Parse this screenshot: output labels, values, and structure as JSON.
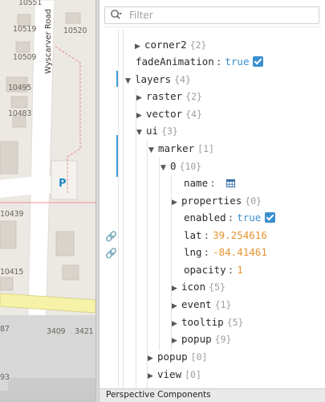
{
  "map": {
    "road_label": "Wyscarver Road",
    "parking_label": "P",
    "addresses": [
      "10551",
      "10519",
      "10520",
      "10509",
      "10495",
      "10483",
      "10439",
      "10415",
      "3409",
      "3421",
      "87",
      "93"
    ]
  },
  "editor": {
    "filter": {
      "placeholder": "Filter",
      "value": ""
    },
    "tree": [
      {
        "key": "corner2",
        "count": "{2}",
        "caret": "collapsed"
      },
      {
        "key": "fadeAnimation",
        "colon": ":",
        "value": "true",
        "value_type": "boolean",
        "checked": true
      },
      {
        "key": "layers",
        "count": "{4}",
        "caret": "expanded"
      },
      {
        "key": "raster",
        "count": "{2}",
        "caret": "collapsed"
      },
      {
        "key": "vector",
        "count": "{4}",
        "caret": "collapsed"
      },
      {
        "key": "ui",
        "count": "{3}",
        "caret": "expanded"
      },
      {
        "key": "marker",
        "count": "[1]",
        "caret": "expanded"
      },
      {
        "key": "0",
        "count": "{10}",
        "caret": "expanded"
      },
      {
        "key": "name",
        "colon": ":",
        "value_type": "dataset-icon"
      },
      {
        "key": "properties",
        "count": "{0}",
        "caret": "collapsed"
      },
      {
        "key": "enabled",
        "colon": ":",
        "value": "true",
        "value_type": "boolean",
        "checked": true
      },
      {
        "key": "lat",
        "colon": ":",
        "value": "39.254616",
        "value_type": "number"
      },
      {
        "key": "lng",
        "colon": ":",
        "value": "-84.41461",
        "value_type": "number"
      },
      {
        "key": "opacity",
        "colon": ":",
        "value": "1",
        "value_type": "number"
      },
      {
        "key": "icon",
        "count": "{5}",
        "caret": "collapsed"
      },
      {
        "key": "event",
        "count": "{1}",
        "caret": "collapsed"
      },
      {
        "key": "tooltip",
        "count": "{5}",
        "caret": "collapsed"
      },
      {
        "key": "popup",
        "count": "{9}",
        "caret": "collapsed"
      },
      {
        "key": "popup",
        "count": "[0]",
        "caret": "collapsed"
      },
      {
        "key": "view",
        "count": "[0]",
        "caret": "collapsed"
      }
    ],
    "bottom_tab": "Perspective Components"
  },
  "colors": {
    "accent": "#3a8fd0",
    "number_value": "#e6922e",
    "count_text": "#9e9e9e"
  },
  "icons": {
    "filter": "search-icon",
    "link": "link-icon",
    "checkbox": "checkbox-checked-icon",
    "name_value": "dataset-grid-icon",
    "caret_collapsed": "caret-right-icon",
    "caret_expanded": "caret-down-icon"
  }
}
